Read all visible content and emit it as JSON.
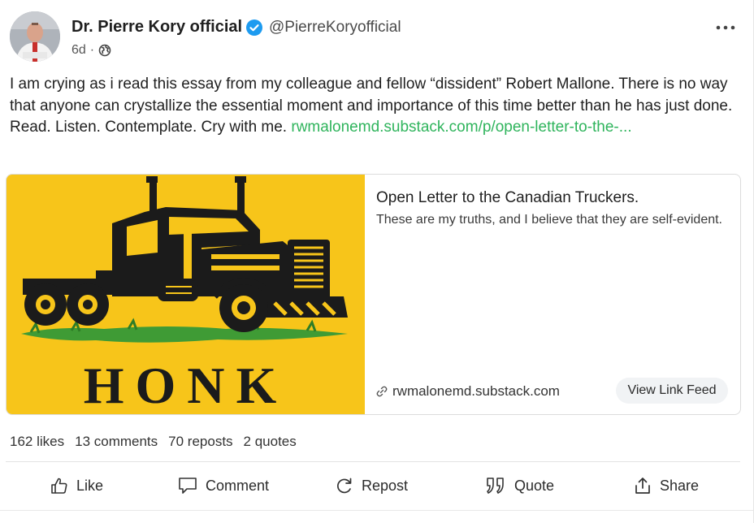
{
  "post": {
    "author_name": "Dr. Pierre Kory official",
    "handle": "@PierreKoryofficial",
    "time_ago": "6d",
    "separator": "·",
    "visibility_icon": "globe-icon",
    "more_icon": "more-horizontal-icon",
    "verified_icon": "verified-badge-icon",
    "body_text": "I am crying as i read this essay from my colleague and fellow “dissident” Robert Mallone. There is no way that anyone can crystallize the essential moment and importance of this time better than he has just done. Read. Listen. Contemplate. Cry with me. ",
    "body_link": "rwmalonemd.substack.com/p/open-letter-to-the-..."
  },
  "card": {
    "image_text": "HONK",
    "title": "Open Letter to the Canadian Truckers.",
    "description": "These are my truths, and I believe that they are self-evident.",
    "domain": "rwmalonemd.substack.com",
    "view_feed_label": "View Link Feed"
  },
  "stats": {
    "likes": "162 likes",
    "comments": "13 comments",
    "reposts": "70 reposts",
    "quotes": "2 quotes"
  },
  "actions": {
    "like": "Like",
    "comment": "Comment",
    "repost": "Repost",
    "quote": "Quote",
    "share": "Share"
  },
  "colors": {
    "link": "#2fb45c",
    "verified": "#1d9bf0",
    "honk_background": "#f7c51a"
  }
}
